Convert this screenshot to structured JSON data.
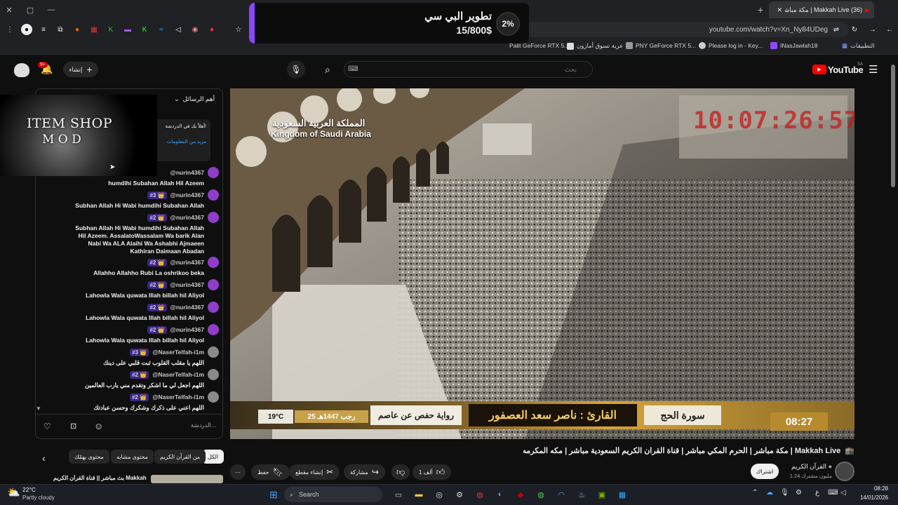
{
  "browser": {
    "tab_title": "(36) Makkah Live | مكة مباشر",
    "tab_count": "(36)",
    "url": "youtube.com/watch?v=Xn_Ny84UDeg",
    "bookmarks": [
      {
        "label": "Palit GeForce RTX 5...",
        "color": "#4a4a4a"
      },
      {
        "label": "عربة تسوق أمازون",
        "color": "#e5e5e5"
      },
      {
        "label": "PNY GeForce RTX 5...",
        "color": "#9a9a9a"
      },
      {
        "label": "Please log in - Key...",
        "color": "#cccccc"
      },
      {
        "label": "INasJawlah18",
        "color": "#9147ff"
      },
      {
        "label": "التطبيقات",
        "color": "#6b8cff"
      }
    ]
  },
  "donation": {
    "title": "تطوير البي سي",
    "amount": "15/800$",
    "percent": "2%",
    "progress": 0.02,
    "accent": "#8b46ff"
  },
  "youtube": {
    "logo": "YouTube",
    "region": "SA",
    "search_placeholder": "بحث",
    "search_lang": "⌨",
    "create_label": "إنشاء",
    "notif_count": "9+"
  },
  "chat": {
    "header": "أهم الرسائل",
    "pinned_text": "أهلاً بك في الدردشة!",
    "pinned_sub": "مزيد من المعلومات",
    "overlay_line1": "ITEM SHOP",
    "overlay_line2": "M O D",
    "input_placeholder": "الدردشة...",
    "messages": [
      {
        "user": "@nurin4367",
        "badge": "",
        "text": "humdihi Subahan Allah Hil Azeem",
        "naser": false
      },
      {
        "user": "@nurin4367",
        "badge": "#3 👑",
        "text": "Subhan Allah Hi Wabi humdihi Subahan Allah Hil Azeem",
        "naser": false
      },
      {
        "user": "@nurin4367",
        "badge": "#2 👑",
        "text": "Subhan Allah Hi Wabi humdihi Subahan Allah Hil Azeem. AssalatoWassalam Wa barik Alan Nabi Wa ALA Alaihi Wa Ashabhi Ajmaeen Kathiran Daimaan Abadan",
        "naser": false
      },
      {
        "user": "@nurin4367",
        "badge": "#2 👑",
        "text": "Allahho Allahho Rubi La oshrikoo beka shailaan abadan",
        "naser": false
      },
      {
        "user": "@nurin4367",
        "badge": "#2 👑",
        "text": "Lahowla Wala quwata Illah billah hil Aliyol Aazeem",
        "naser": false
      },
      {
        "user": "@nurin4367",
        "badge": "#2 👑",
        "text": "Lahowla Wala quwata Illah billah hil Aliyol Aazeem",
        "naser": false
      },
      {
        "user": "@nurin4367",
        "badge": "#2 👑",
        "text": "Lahowla Wala quwata Illah billah hil Aliyol Aazeem",
        "naser": false
      },
      {
        "user": "@NaserTelfah-i1m",
        "badge": "#3 👑",
        "text": "اللهم يا مقلب القلوب ثبت قلبي على دينك",
        "naser": true
      },
      {
        "user": "@NaserTelfah-i1m",
        "badge": "#2 👑",
        "text": "اللهم اجعل لي ما اشكر وتقدم مني يارب العالمين",
        "naser": true
      },
      {
        "user": "@NaserTelfah-i1m",
        "badge": "#2 👑",
        "text": "اللهم اعني على ذكرك وشكرك وحسن عبادتك",
        "naser": true
      }
    ]
  },
  "video": {
    "brand_ar": "المملكة العربية السعودية",
    "brand_en": "Kingdom of Saudi Arabia",
    "clock": "10:07:26:57",
    "surah": "سورة الحج",
    "reciter": "القارئ : ناصر سعد العصفور",
    "riwaya": "رواية حفص عن عاصم",
    "hijri": "25 رجب 1447هـ",
    "temp": "19°C",
    "time": "08:27"
  },
  "watch": {
    "title": "مكة مباشر | الحرم المكي مباشر | قناة القران الكريم السعودية مباشر | مكه المكرمه مبا | Makkah Live",
    "channel": "القرآن الكريم",
    "subs": "1.24 مليون مشترك",
    "subscribe": "اشتراك",
    "likes": "1 ألف",
    "share": "مشاركة",
    "clip": "إنشاء مقطع",
    "save": "حفظ",
    "chips": [
      "الكل",
      "من القرآن الكريم",
      "محتوى مشابه",
      "محتوى يهمّك"
    ],
    "rec_title": "بث مباشر || قناة القرآن الكريم Makkah"
  },
  "taskbar": {
    "weather_temp": "22°C",
    "weather_desc": "Partly cloudy",
    "search": "Search",
    "time": "08:28",
    "date": "14/01/2026",
    "lang": "ع"
  }
}
